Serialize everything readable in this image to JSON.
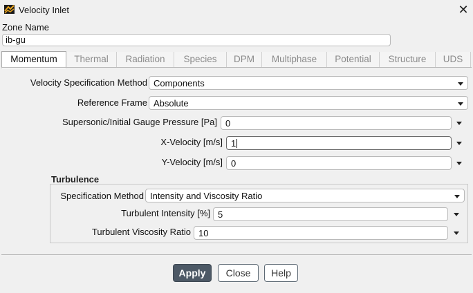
{
  "window": {
    "title": "Velocity Inlet",
    "close_icon": "close-icon"
  },
  "zone": {
    "label": "Zone Name",
    "value": "ib-gu"
  },
  "tabs": [
    {
      "label": "Momentum",
      "active": true
    },
    {
      "label": "Thermal",
      "active": false
    },
    {
      "label": "Radiation",
      "active": false
    },
    {
      "label": "Species",
      "active": false
    },
    {
      "label": "DPM",
      "active": false
    },
    {
      "label": "Multiphase",
      "active": false
    },
    {
      "label": "Potential",
      "active": false
    },
    {
      "label": "Structure",
      "active": false
    },
    {
      "label": "UDS",
      "active": false
    }
  ],
  "momentum": {
    "velocity_spec_method": {
      "label": "Velocity Specification Method",
      "value": "Components"
    },
    "reference_frame": {
      "label": "Reference Frame",
      "value": "Absolute"
    },
    "gauge_pressure": {
      "label": "Supersonic/Initial Gauge Pressure [Pa]",
      "value": "0"
    },
    "x_velocity": {
      "label": "X-Velocity [m/s]",
      "value": "1"
    },
    "y_velocity": {
      "label": "Y-Velocity [m/s]",
      "value": "0"
    }
  },
  "turbulence": {
    "title": "Turbulence",
    "spec_method": {
      "label": "Specification Method",
      "value": "Intensity and Viscosity Ratio"
    },
    "intensity": {
      "label": "Turbulent Intensity [%]",
      "value": "5"
    },
    "viscosity_ratio": {
      "label": "Turbulent Viscosity Ratio",
      "value": "10"
    }
  },
  "buttons": {
    "apply": "Apply",
    "close": "Close",
    "help": "Help"
  },
  "colors": {
    "apply_bg": "#4d5966",
    "window_bg": "#f0f0f0"
  }
}
